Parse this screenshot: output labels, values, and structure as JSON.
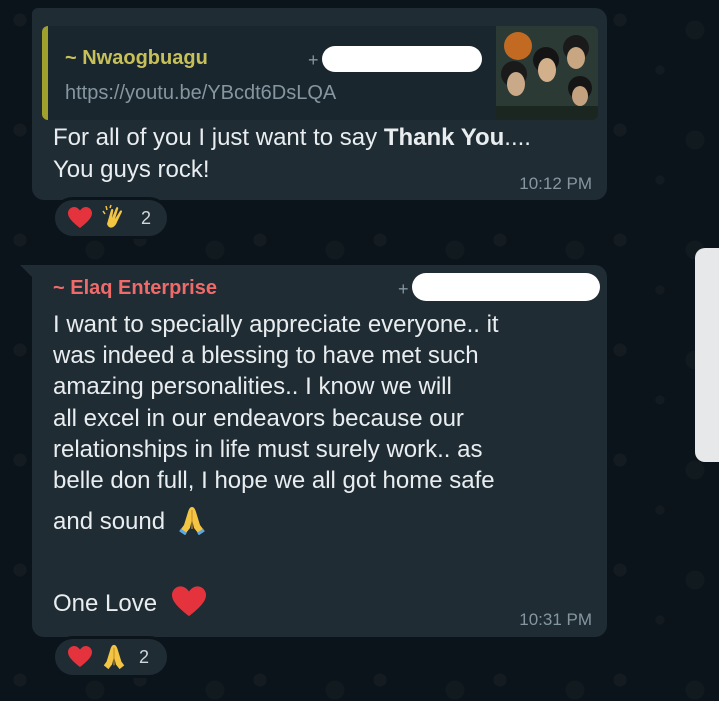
{
  "messages": [
    {
      "quote_author": "~ Nwaogbuagu",
      "quote_phone_prefix": "+",
      "quote_url": "https://youtu.be/YBcdt6DsLQA",
      "text_line1_prefix": "For all of you I just want to say ",
      "text_line1_bold": "Thank You",
      "text_line1_suffix": "....",
      "text_line2": "You guys rock!",
      "time": "10:12 PM",
      "reaction_count": "2"
    },
    {
      "author": "~ Elaq Enterprise",
      "phone_prefix": "+",
      "text_lines": [
        "I want to specially appreciate everyone.. it",
        "was indeed a blessing to have met such",
        "amazing personalities.. I know we will",
        "all excel in our endeavors because our",
        "relationships in life must surely work.. as",
        "belle don full, I hope we all got home safe",
        "and sound"
      ],
      "closing": "One Love",
      "time": "10:31 PM",
      "reaction_count": "2"
    }
  ],
  "icons": {
    "reaction1": [
      "heart-icon",
      "clapping-hands-icon"
    ],
    "reaction2": [
      "heart-icon",
      "folded-hands-icon"
    ],
    "inline": [
      "folded-hands-icon",
      "heart-icon"
    ]
  },
  "colors": {
    "background": "#0b141a",
    "bubble": "#1f2c34",
    "quote_author": "#c7c05a",
    "author2": "#f06a6a",
    "meta": "#8696a0"
  }
}
